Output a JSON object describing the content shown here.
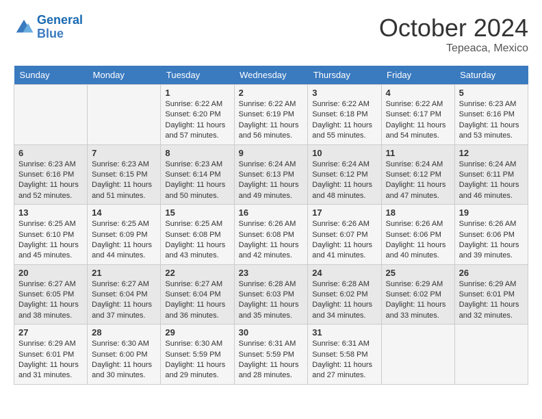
{
  "header": {
    "logo_line1": "General",
    "logo_line2": "Blue",
    "month": "October 2024",
    "location": "Tepeaca, Mexico"
  },
  "weekdays": [
    "Sunday",
    "Monday",
    "Tuesday",
    "Wednesday",
    "Thursday",
    "Friday",
    "Saturday"
  ],
  "weeks": [
    [
      {
        "day": "",
        "sunrise": "",
        "sunset": "",
        "daylight": ""
      },
      {
        "day": "",
        "sunrise": "",
        "sunset": "",
        "daylight": ""
      },
      {
        "day": "1",
        "sunrise": "Sunrise: 6:22 AM",
        "sunset": "Sunset: 6:20 PM",
        "daylight": "Daylight: 11 hours and 57 minutes."
      },
      {
        "day": "2",
        "sunrise": "Sunrise: 6:22 AM",
        "sunset": "Sunset: 6:19 PM",
        "daylight": "Daylight: 11 hours and 56 minutes."
      },
      {
        "day": "3",
        "sunrise": "Sunrise: 6:22 AM",
        "sunset": "Sunset: 6:18 PM",
        "daylight": "Daylight: 11 hours and 55 minutes."
      },
      {
        "day": "4",
        "sunrise": "Sunrise: 6:22 AM",
        "sunset": "Sunset: 6:17 PM",
        "daylight": "Daylight: 11 hours and 54 minutes."
      },
      {
        "day": "5",
        "sunrise": "Sunrise: 6:23 AM",
        "sunset": "Sunset: 6:16 PM",
        "daylight": "Daylight: 11 hours and 53 minutes."
      }
    ],
    [
      {
        "day": "6",
        "sunrise": "Sunrise: 6:23 AM",
        "sunset": "Sunset: 6:16 PM",
        "daylight": "Daylight: 11 hours and 52 minutes."
      },
      {
        "day": "7",
        "sunrise": "Sunrise: 6:23 AM",
        "sunset": "Sunset: 6:15 PM",
        "daylight": "Daylight: 11 hours and 51 minutes."
      },
      {
        "day": "8",
        "sunrise": "Sunrise: 6:23 AM",
        "sunset": "Sunset: 6:14 PM",
        "daylight": "Daylight: 11 hours and 50 minutes."
      },
      {
        "day": "9",
        "sunrise": "Sunrise: 6:24 AM",
        "sunset": "Sunset: 6:13 PM",
        "daylight": "Daylight: 11 hours and 49 minutes."
      },
      {
        "day": "10",
        "sunrise": "Sunrise: 6:24 AM",
        "sunset": "Sunset: 6:12 PM",
        "daylight": "Daylight: 11 hours and 48 minutes."
      },
      {
        "day": "11",
        "sunrise": "Sunrise: 6:24 AM",
        "sunset": "Sunset: 6:12 PM",
        "daylight": "Daylight: 11 hours and 47 minutes."
      },
      {
        "day": "12",
        "sunrise": "Sunrise: 6:24 AM",
        "sunset": "Sunset: 6:11 PM",
        "daylight": "Daylight: 11 hours and 46 minutes."
      }
    ],
    [
      {
        "day": "13",
        "sunrise": "Sunrise: 6:25 AM",
        "sunset": "Sunset: 6:10 PM",
        "daylight": "Daylight: 11 hours and 45 minutes."
      },
      {
        "day": "14",
        "sunrise": "Sunrise: 6:25 AM",
        "sunset": "Sunset: 6:09 PM",
        "daylight": "Daylight: 11 hours and 44 minutes."
      },
      {
        "day": "15",
        "sunrise": "Sunrise: 6:25 AM",
        "sunset": "Sunset: 6:08 PM",
        "daylight": "Daylight: 11 hours and 43 minutes."
      },
      {
        "day": "16",
        "sunrise": "Sunrise: 6:26 AM",
        "sunset": "Sunset: 6:08 PM",
        "daylight": "Daylight: 11 hours and 42 minutes."
      },
      {
        "day": "17",
        "sunrise": "Sunrise: 6:26 AM",
        "sunset": "Sunset: 6:07 PM",
        "daylight": "Daylight: 11 hours and 41 minutes."
      },
      {
        "day": "18",
        "sunrise": "Sunrise: 6:26 AM",
        "sunset": "Sunset: 6:06 PM",
        "daylight": "Daylight: 11 hours and 40 minutes."
      },
      {
        "day": "19",
        "sunrise": "Sunrise: 6:26 AM",
        "sunset": "Sunset: 6:06 PM",
        "daylight": "Daylight: 11 hours and 39 minutes."
      }
    ],
    [
      {
        "day": "20",
        "sunrise": "Sunrise: 6:27 AM",
        "sunset": "Sunset: 6:05 PM",
        "daylight": "Daylight: 11 hours and 38 minutes."
      },
      {
        "day": "21",
        "sunrise": "Sunrise: 6:27 AM",
        "sunset": "Sunset: 6:04 PM",
        "daylight": "Daylight: 11 hours and 37 minutes."
      },
      {
        "day": "22",
        "sunrise": "Sunrise: 6:27 AM",
        "sunset": "Sunset: 6:04 PM",
        "daylight": "Daylight: 11 hours and 36 minutes."
      },
      {
        "day": "23",
        "sunrise": "Sunrise: 6:28 AM",
        "sunset": "Sunset: 6:03 PM",
        "daylight": "Daylight: 11 hours and 35 minutes."
      },
      {
        "day": "24",
        "sunrise": "Sunrise: 6:28 AM",
        "sunset": "Sunset: 6:02 PM",
        "daylight": "Daylight: 11 hours and 34 minutes."
      },
      {
        "day": "25",
        "sunrise": "Sunrise: 6:29 AM",
        "sunset": "Sunset: 6:02 PM",
        "daylight": "Daylight: 11 hours and 33 minutes."
      },
      {
        "day": "26",
        "sunrise": "Sunrise: 6:29 AM",
        "sunset": "Sunset: 6:01 PM",
        "daylight": "Daylight: 11 hours and 32 minutes."
      }
    ],
    [
      {
        "day": "27",
        "sunrise": "Sunrise: 6:29 AM",
        "sunset": "Sunset: 6:01 PM",
        "daylight": "Daylight: 11 hours and 31 minutes."
      },
      {
        "day": "28",
        "sunrise": "Sunrise: 6:30 AM",
        "sunset": "Sunset: 6:00 PM",
        "daylight": "Daylight: 11 hours and 30 minutes."
      },
      {
        "day": "29",
        "sunrise": "Sunrise: 6:30 AM",
        "sunset": "Sunset: 5:59 PM",
        "daylight": "Daylight: 11 hours and 29 minutes."
      },
      {
        "day": "30",
        "sunrise": "Sunrise: 6:31 AM",
        "sunset": "Sunset: 5:59 PM",
        "daylight": "Daylight: 11 hours and 28 minutes."
      },
      {
        "day": "31",
        "sunrise": "Sunrise: 6:31 AM",
        "sunset": "Sunset: 5:58 PM",
        "daylight": "Daylight: 11 hours and 27 minutes."
      },
      {
        "day": "",
        "sunrise": "",
        "sunset": "",
        "daylight": ""
      },
      {
        "day": "",
        "sunrise": "",
        "sunset": "",
        "daylight": ""
      }
    ]
  ]
}
